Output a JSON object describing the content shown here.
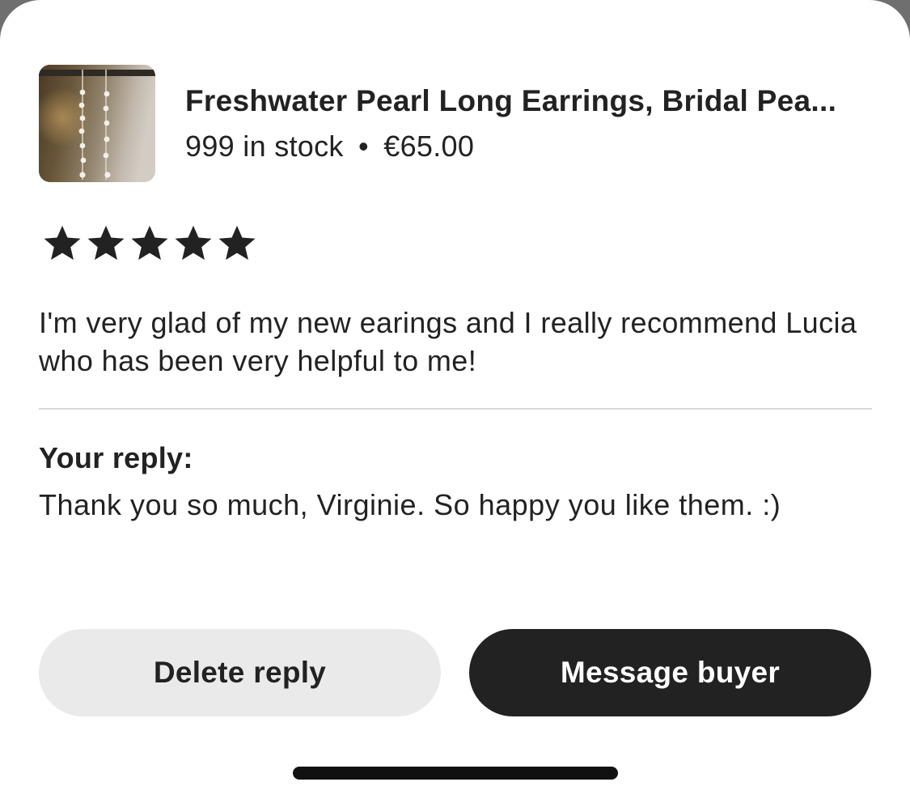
{
  "product": {
    "title": "Freshwater Pearl Long Earrings, Bridal Pea...",
    "stock": "999 in stock",
    "separator": "•",
    "price": "€65.00",
    "thumbnail_icon": "pearl-earrings-photo"
  },
  "review": {
    "rating": 5,
    "rating_max": 5,
    "star_color": "#222222",
    "text": "I'm very glad of my new earings and I really recommend Lucia who has been very helpful to me!"
  },
  "reply": {
    "label": "Your reply:",
    "text": "Thank you so much, Virginie. So happy you like them. :)"
  },
  "actions": {
    "delete_label": "Delete reply",
    "message_label": "Message buyer",
    "primary_color": "#222222",
    "secondary_color": "#eaeaea"
  }
}
